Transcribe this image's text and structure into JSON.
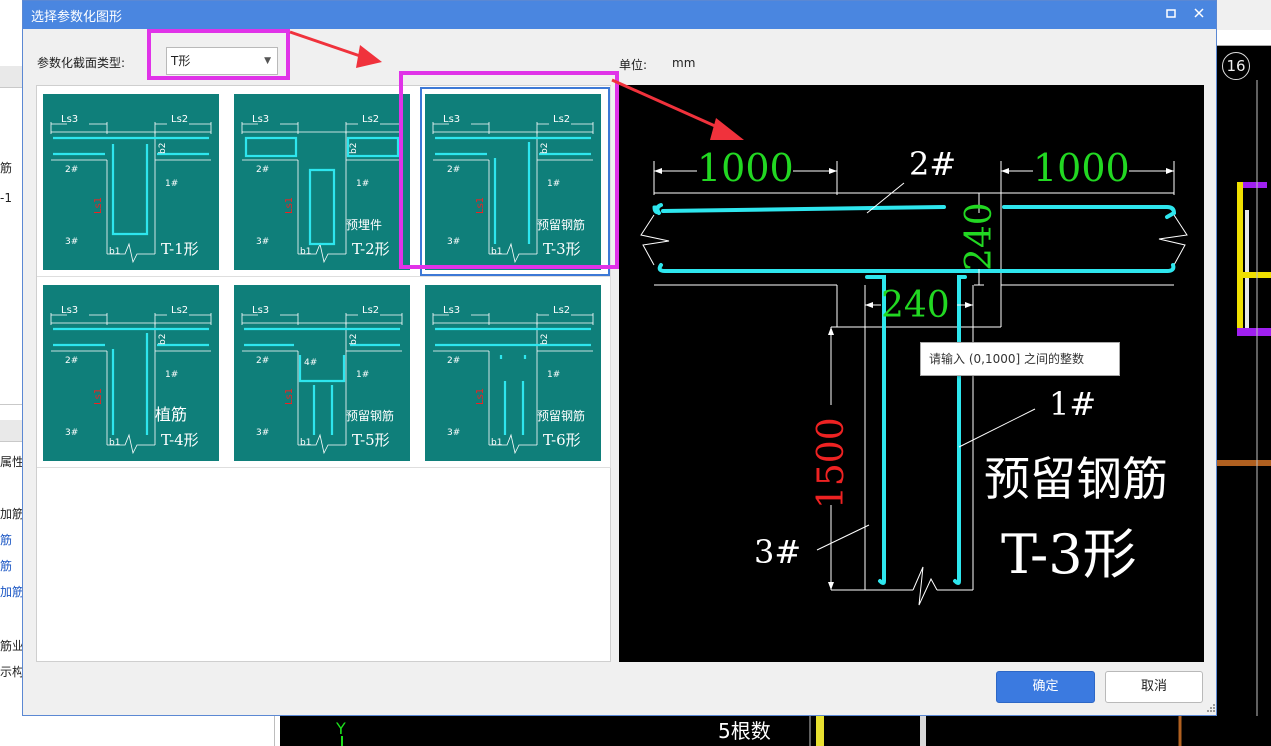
{
  "dialog": {
    "title": "选择参数化图形",
    "maximize_icon": "square-icon",
    "close_icon": "x-icon"
  },
  "section_type": {
    "label": "参数化截面类型:",
    "value": "T形"
  },
  "unit": {
    "label": "单位:",
    "value": "mm"
  },
  "shapes": [
    {
      "id": "T-1",
      "caption": "T-1形",
      "sub": ""
    },
    {
      "id": "T-2",
      "caption": "T-2形",
      "sub": "预埋件"
    },
    {
      "id": "T-3",
      "caption": "T-3形",
      "sub": "预留钢筋",
      "selected": true
    },
    {
      "id": "T-4",
      "caption": "T-4形",
      "sub": "植筋"
    },
    {
      "id": "T-5",
      "caption": "T-5形",
      "sub": "预留钢筋"
    },
    {
      "id": "T-6",
      "caption": "T-6形",
      "sub": "预留钢筋"
    }
  ],
  "thumb_labels": {
    "ls3": "Ls3",
    "ls2": "Ls2",
    "b2": "b2",
    "b1": "b1",
    "ls1": "Ls1",
    "r1": "1#",
    "r2": "2#",
    "r3": "3#",
    "r4": "4#"
  },
  "preview": {
    "left_width": "1000",
    "right_width": "1000",
    "flange_thickness": "240",
    "web_width": "240",
    "web_length": "1500",
    "rebar_1": "1#",
    "rebar_2": "2#",
    "rebar_3": "3#",
    "sub_title": "预留钢筋",
    "title": "T-3形"
  },
  "tooltip": "请输入 (0,1000] 之间的整数",
  "buttons": {
    "ok": "确定",
    "cancel": "取消"
  },
  "background": {
    "left_rows": [
      "筋",
      "-1",
      "属性",
      "加筋",
      "筋",
      "筋",
      "加筋",
      "筋业",
      "示构"
    ],
    "axis_number": "16",
    "cad_text": "5根数",
    "axis_y": "Y"
  },
  "colors": {
    "titlebar": "#4a86e0",
    "highlight": "#e033e8",
    "arrow": "#f0323c",
    "thumb_bg": "#0f7f7a",
    "rebar": "#2ee6ee",
    "dimension_green": "#22d822",
    "dimension_red": "#ee2222"
  }
}
